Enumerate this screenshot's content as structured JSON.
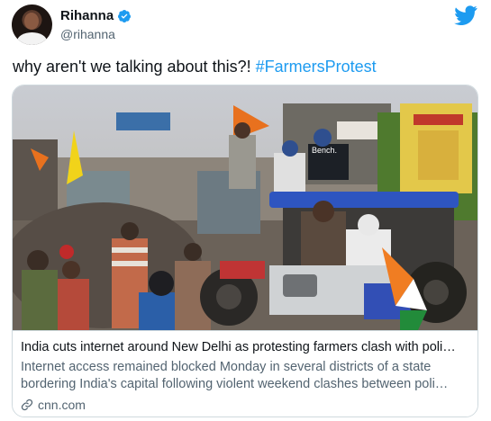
{
  "author": {
    "display_name": "Rihanna",
    "handle": "@rihanna",
    "verified": true,
    "avatar_icon": "profile-photo"
  },
  "brand": {
    "icon": "twitter-bird-icon",
    "color": "#1d9bf0"
  },
  "tweet": {
    "text_prefix": "why aren't we talking about this?! ",
    "hashtag": "#FarmersProtest"
  },
  "card": {
    "title": "India cuts internet around New Delhi as protesting farmers clash with poli…",
    "description": "Internet access remained blocked Monday in several districts of a state bordering India's capital following violent weekend clashes between poli…",
    "source": "cnn.com",
    "source_icon": "link-icon",
    "image_sign_text": "Bench."
  },
  "colors": {
    "link": "#1d9bf0",
    "text": "#0f1419",
    "secondary": "#536471",
    "border": "#cfd9de"
  }
}
